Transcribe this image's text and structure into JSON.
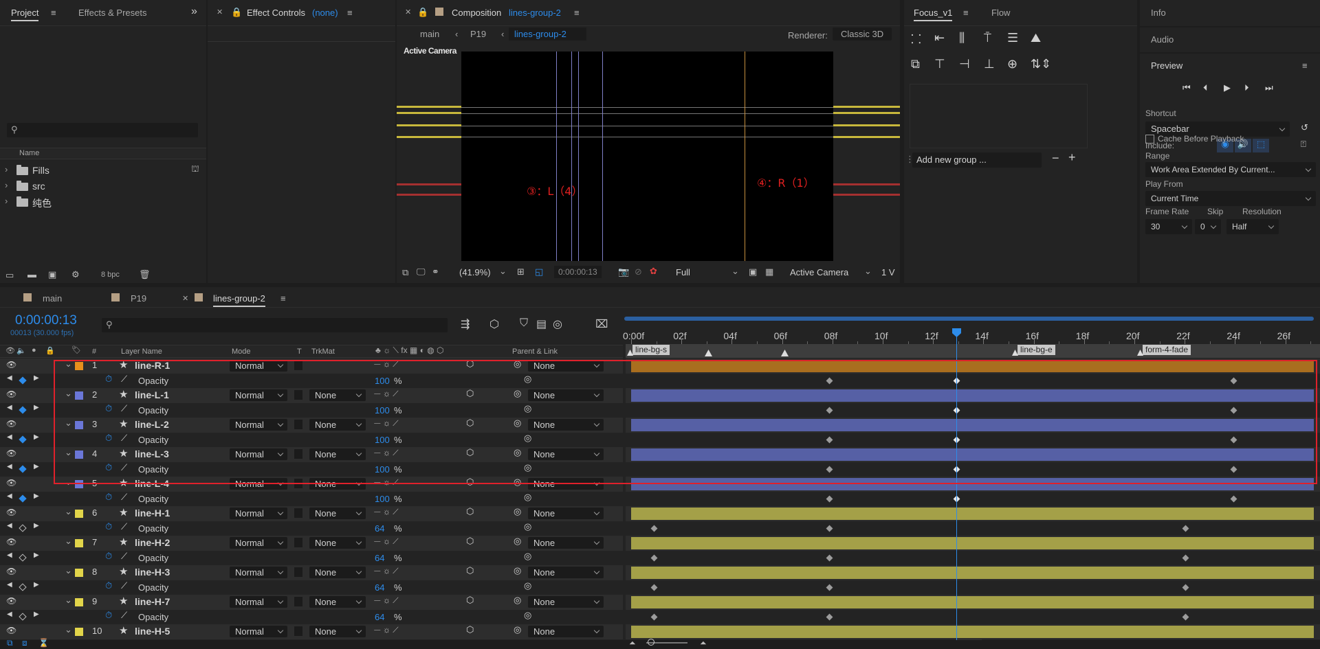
{
  "project": {
    "tab": "Project",
    "tab2": "Effects & Presets",
    "search_placeholder": "",
    "col_name": "Name",
    "items": [
      {
        "label": "Fills"
      },
      {
        "label": "src"
      },
      {
        "label": "纯色"
      }
    ],
    "bpc": "8 bpc"
  },
  "effect_controls": {
    "title": "Effect Controls",
    "value": "(none)"
  },
  "composition": {
    "title": "Composition",
    "name": "lines-group-2",
    "breadcrumb": [
      "main",
      "P19",
      "lines-group-2"
    ],
    "renderer_label": "Renderer:",
    "renderer": "Classic 3D",
    "camera_label": "Active Camera",
    "annot_left": "③：L（4）",
    "annot_right": "④：R（1）",
    "zoom": "(41.9%)",
    "timecode": "0:00:00:13",
    "resolution": "Full",
    "view": "Active Camera",
    "views": "1 V"
  },
  "focus": {
    "tab": "Focus_v1",
    "tab2": "Flow",
    "add_group": "Add new group ..."
  },
  "right": {
    "info": "Info",
    "audio": "Audio",
    "preview": "Preview",
    "shortcut_label": "Shortcut",
    "shortcut": "Spacebar",
    "include_label": "Include:",
    "cache_label": "Cache Before Playback",
    "range_label": "Range",
    "range": "Work Area Extended By Current...",
    "play_from_label": "Play From",
    "play_from": "Current Time",
    "frame_rate_label": "Frame Rate",
    "skip_label": "Skip",
    "resolution_label": "Resolution",
    "frame_rate": "30",
    "skip": "0",
    "resolution": "Half"
  },
  "timeline": {
    "tabs": [
      "main",
      "P19",
      "lines-group-2"
    ],
    "timecode": "0:00:00:13",
    "frames": "00013 (30.000 fps)",
    "col_layer_name": "Layer Name",
    "col_mode": "Mode",
    "col_t": "T",
    "col_trkmat": "TrkMat",
    "col_parent": "Parent & Link",
    "col_hash": "#",
    "ruler": [
      "0:00f",
      "02f",
      "04f",
      "06f",
      "08f",
      "10f",
      "12f",
      "14f",
      "16f",
      "18f",
      "20f",
      "22f",
      "24f",
      "26f"
    ],
    "markers": [
      "line-bg-s",
      "line-bg-e",
      "form-4-fade"
    ],
    "rows": [
      {
        "type": "layer",
        "num": "1",
        "name": "line-R-1",
        "mode": "Normal",
        "trkmat": "",
        "parent": "None",
        "color": "#e8901c"
      },
      {
        "type": "prop",
        "name": "Opacity",
        "value": "100",
        "unit": "%"
      },
      {
        "type": "layer",
        "num": "2",
        "name": "line-L-1",
        "mode": "Normal",
        "trkmat": "None",
        "parent": "None",
        "color": "#6b77d8"
      },
      {
        "type": "prop",
        "name": "Opacity",
        "value": "100",
        "unit": "%"
      },
      {
        "type": "layer",
        "num": "3",
        "name": "line-L-2",
        "mode": "Normal",
        "trkmat": "None",
        "parent": "None",
        "color": "#6b77d8"
      },
      {
        "type": "prop",
        "name": "Opacity",
        "value": "100",
        "unit": "%"
      },
      {
        "type": "layer",
        "num": "4",
        "name": "line-L-3",
        "mode": "Normal",
        "trkmat": "None",
        "parent": "None",
        "color": "#6b77d8"
      },
      {
        "type": "prop",
        "name": "Opacity",
        "value": "100",
        "unit": "%"
      },
      {
        "type": "layer",
        "num": "5",
        "name": "line-L-4",
        "mode": "Normal",
        "trkmat": "None",
        "parent": "None",
        "color": "#6b77d8"
      },
      {
        "type": "prop",
        "name": "Opacity",
        "value": "100",
        "unit": "%"
      },
      {
        "type": "layer",
        "num": "6",
        "name": "line-H-1",
        "mode": "Normal",
        "trkmat": "None",
        "parent": "None",
        "color": "#e2d54a"
      },
      {
        "type": "prop",
        "name": "Opacity",
        "value": "64",
        "unit": "%"
      },
      {
        "type": "layer",
        "num": "7",
        "name": "line-H-2",
        "mode": "Normal",
        "trkmat": "None",
        "parent": "None",
        "color": "#e2d54a"
      },
      {
        "type": "prop",
        "name": "Opacity",
        "value": "64",
        "unit": "%"
      },
      {
        "type": "layer",
        "num": "8",
        "name": "line-H-3",
        "mode": "Normal",
        "trkmat": "None",
        "parent": "None",
        "color": "#e2d54a"
      },
      {
        "type": "prop",
        "name": "Opacity",
        "value": "64",
        "unit": "%"
      },
      {
        "type": "layer",
        "num": "9",
        "name": "line-H-7",
        "mode": "Normal",
        "trkmat": "None",
        "parent": "None",
        "color": "#e2d54a"
      },
      {
        "type": "prop",
        "name": "Opacity",
        "value": "64",
        "unit": "%"
      },
      {
        "type": "layer",
        "num": "10",
        "name": "line-H-5",
        "mode": "Normal",
        "trkmat": "None",
        "parent": "None",
        "color": "#e2d54a"
      }
    ]
  }
}
